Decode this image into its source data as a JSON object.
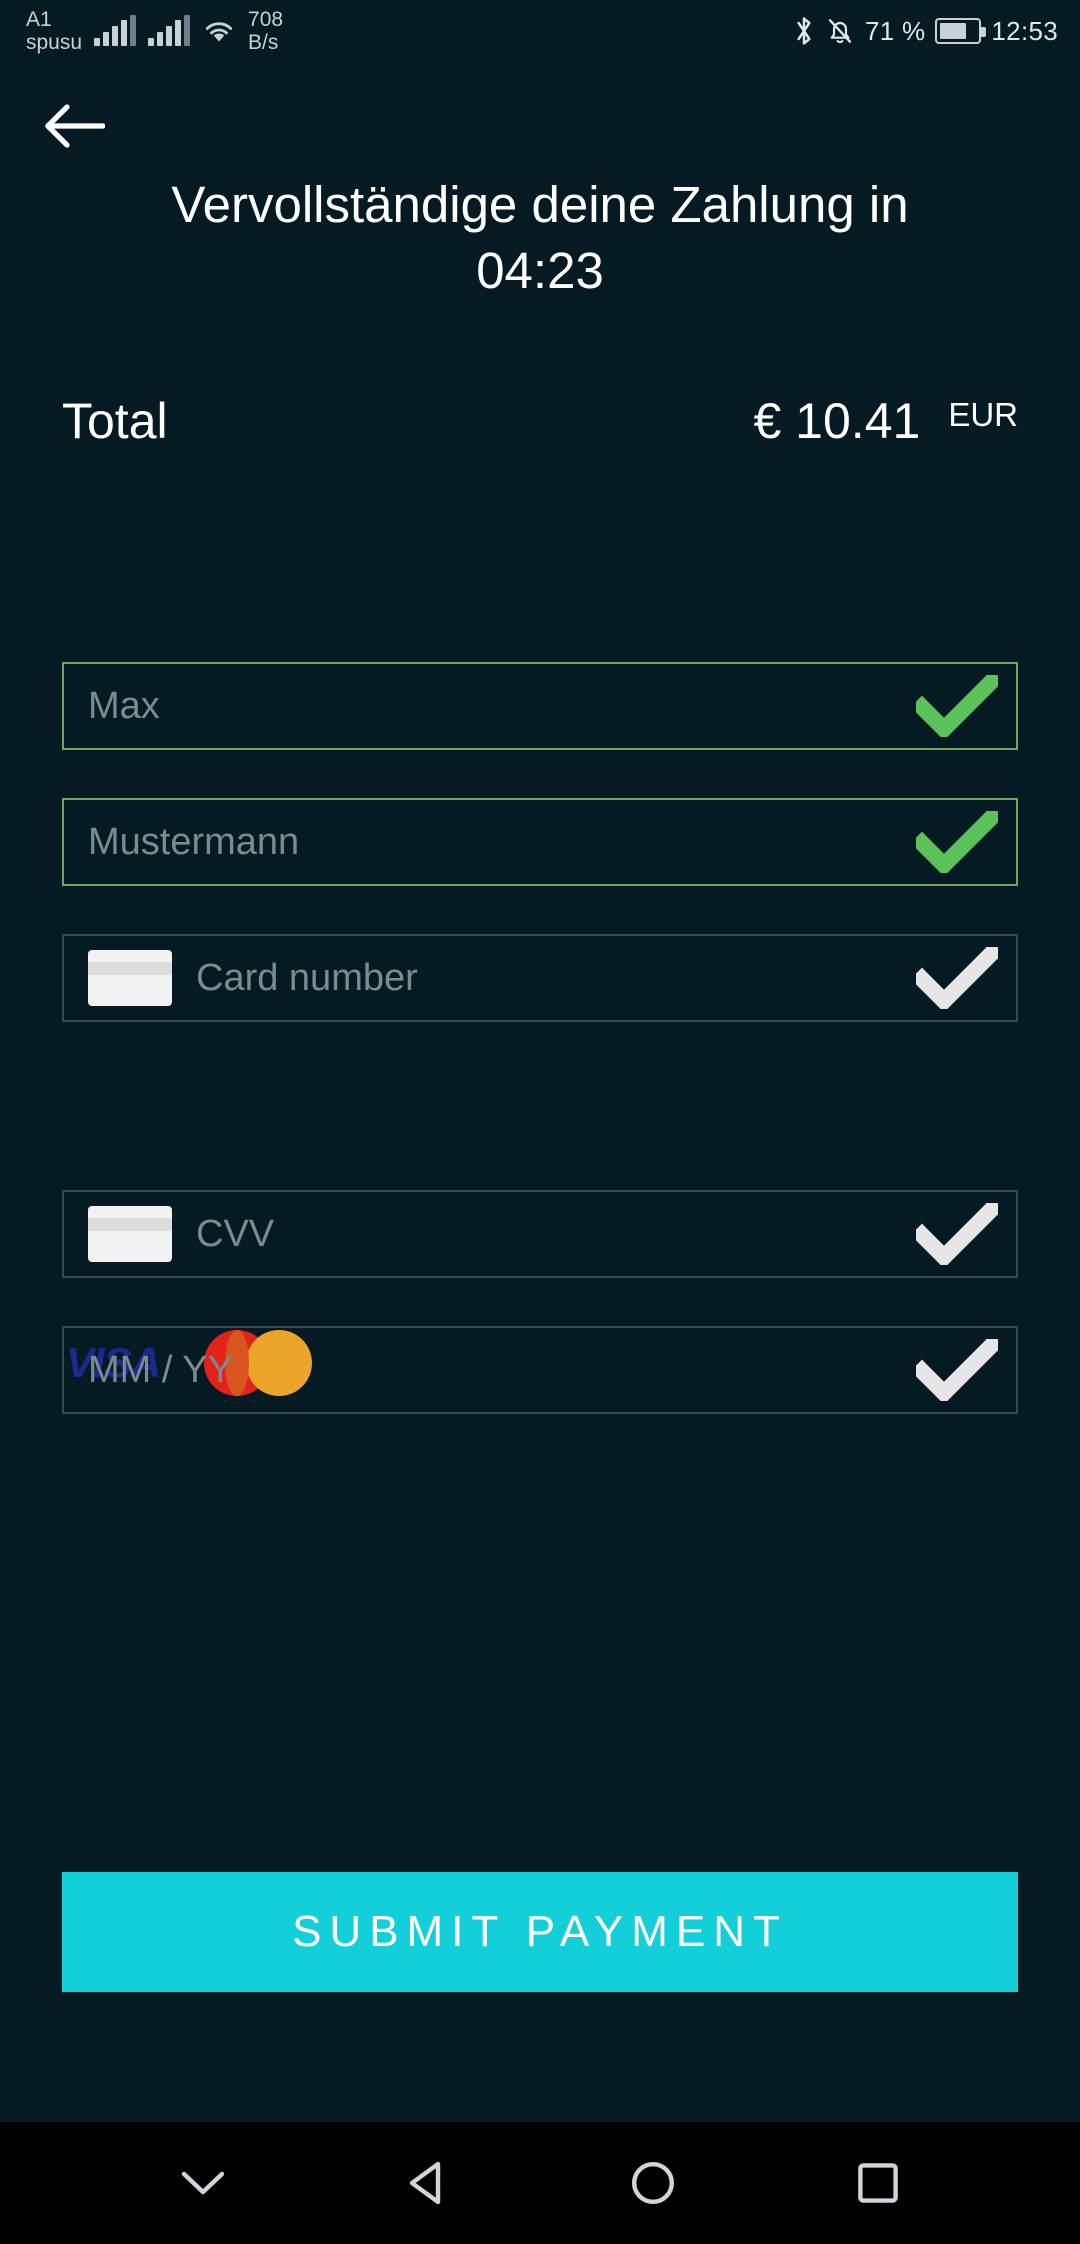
{
  "statusbar": {
    "carrier_line1": "A1",
    "carrier_line2": "spusu",
    "signal_icon": "signal-bars-icon",
    "signal_icon_2": "signal-bars-icon",
    "wifi_icon": "wifi-icon",
    "net_speed_value": "708",
    "net_speed_unit": "B/s",
    "bluetooth_icon": "bluetooth-icon",
    "mute_icon": "bell-muted-icon",
    "battery_percent": "71 %",
    "battery_icon": "battery-icon",
    "clock": "12:53"
  },
  "header": {
    "back_icon": "arrow-left-icon",
    "title_line1": "Vervollständige deine Zahlung in",
    "title_line2": "04:23"
  },
  "total": {
    "label": "Total",
    "amount": "€ 10.41",
    "currency": "EUR"
  },
  "fields": [
    {
      "name": "first-name",
      "placeholder": "Max",
      "valid": true,
      "icon": null,
      "check": "check-icon-green"
    },
    {
      "name": "last-name",
      "placeholder": "Mustermann",
      "valid": true,
      "icon": null,
      "check": "check-icon-green"
    },
    {
      "name": "card-number",
      "placeholder": "Card number",
      "valid": false,
      "icon": "credit-card-icon",
      "check": "check-icon-grey"
    },
    {
      "name": "cvv",
      "placeholder": "CVV",
      "valid": false,
      "icon": "credit-card-icon",
      "check": "check-icon-grey"
    },
    {
      "name": "expiry",
      "placeholder": "MM / YY",
      "valid": false,
      "icon": null,
      "check": "check-icon-grey"
    }
  ],
  "brands": [
    {
      "name": "visa-logo",
      "label": "VISA"
    },
    {
      "name": "mastercard-logo",
      "label": ""
    }
  ],
  "submit": {
    "label": "SUBMIT PAYMENT"
  },
  "navbar": {
    "hide_keyboard_icon": "chevron-down-icon",
    "back_icon": "triangle-back-icon",
    "home_icon": "circle-home-icon",
    "recents_icon": "square-recents-icon"
  },
  "colors": {
    "background": "#061a23",
    "accent": "#12cfd9",
    "valid_border": "#6aa95e",
    "check_green": "#5cc25a",
    "check_grey": "#e6e6e6",
    "field_border": "#3b4a52",
    "placeholder": "#7d8a90",
    "visa_blue": "#1a2a8f",
    "mastercard_red": "#e2231a",
    "mastercard_yellow": "#eba52a"
  }
}
